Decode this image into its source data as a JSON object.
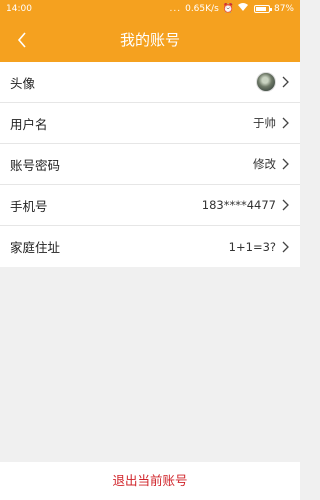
{
  "status": {
    "time": "14:00",
    "dots": "...",
    "speed": "0.65K/s",
    "battery": "87%",
    "battery_level": 0.87
  },
  "nav": {
    "title": "我的账号"
  },
  "rows": [
    {
      "label": "头像",
      "value": ""
    },
    {
      "label": "用户名",
      "value": "于帅"
    },
    {
      "label": "账号密码",
      "value": "修改"
    },
    {
      "label": "手机号",
      "value": "183****4477"
    },
    {
      "label": "家庭住址",
      "value": "1+1=3?"
    }
  ],
  "logout": {
    "label": "退出当前账号"
  },
  "colors": {
    "accent": "#f5a11f",
    "logout": "#d0242a"
  }
}
